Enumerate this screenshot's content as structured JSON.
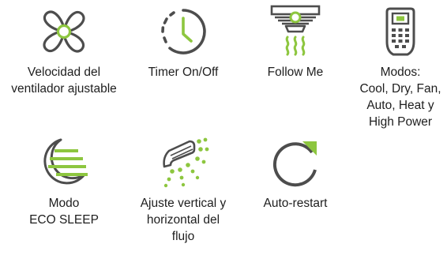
{
  "colors": {
    "accent": "#8dc63f",
    "stroke": "#4d4d4d"
  },
  "features": [
    {
      "icon": "fan-icon",
      "label": "Velocidad del\nventilador ajustable"
    },
    {
      "icon": "timer-icon",
      "label": "Timer On/Off"
    },
    {
      "icon": "follow-me-sensor-icon",
      "label": "Follow Me"
    },
    {
      "icon": "remote-control-icon",
      "label": "Modos:\nCool, Dry, Fan,\nAuto, Heat y\nHigh Power"
    },
    {
      "icon": "moon-eco-sleep-icon",
      "label": "Modo\nECO SLEEP"
    },
    {
      "icon": "airflow-icon",
      "label": "Ajuste vertical y\nhorizontal del\nflujo"
    },
    {
      "icon": "auto-restart-icon",
      "label": "Auto-restart"
    }
  ]
}
